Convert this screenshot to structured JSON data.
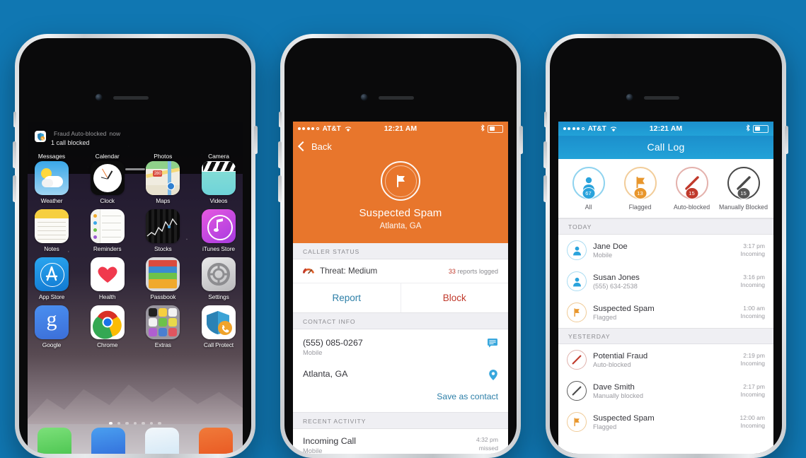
{
  "background_color": "#1077B2",
  "phone1": {
    "name": "iphone-home-screen",
    "notification": {
      "title": "Fraud Auto-blocked",
      "time": "now",
      "body": "1 call blocked"
    },
    "page_dots": {
      "count": 7,
      "active_index": 0
    },
    "apps_row_top_labels": [
      "Messages",
      "Calendar",
      "Photos",
      "Camera"
    ],
    "apps": [
      [
        {
          "label": "Weather",
          "icon": "weather-icon"
        },
        {
          "label": "Clock",
          "icon": "clock-icon"
        },
        {
          "label": "Maps",
          "icon": "maps-icon"
        },
        {
          "label": "Videos",
          "icon": "videos-icon"
        }
      ],
      [
        {
          "label": "Notes",
          "icon": "notes-icon"
        },
        {
          "label": "Reminders",
          "icon": "reminders-icon"
        },
        {
          "label": "Stocks",
          "icon": "stocks-icon"
        },
        {
          "label": "iTunes Store",
          "icon": "itunes-store-icon"
        }
      ],
      [
        {
          "label": "App Store",
          "icon": "app-store-icon"
        },
        {
          "label": "Health",
          "icon": "health-icon"
        },
        {
          "label": "Passbook",
          "icon": "passbook-icon"
        },
        {
          "label": "Settings",
          "icon": "settings-icon"
        }
      ],
      [
        {
          "label": "Google",
          "icon": "google-icon"
        },
        {
          "label": "Chrome",
          "icon": "chrome-icon"
        },
        {
          "label": "Extras",
          "icon": "extras-folder-icon"
        },
        {
          "label": "Call Protect",
          "icon": "call-protect-icon"
        }
      ]
    ],
    "dock": [
      "phone-icon",
      "mail-icon",
      "safari-icon",
      "music-icon"
    ]
  },
  "phone2": {
    "name": "spam-caller-detail",
    "status_bar": {
      "carrier": "AT&T",
      "time": "12:21 AM",
      "signal_dots_filled": 4,
      "signal_dots_total": 5,
      "bluetooth": true,
      "battery_percent": 45
    },
    "nav": {
      "back_label": "Back"
    },
    "hero": {
      "icon": "flag-badge-icon",
      "title": "Suspected Spam",
      "subtitle": "Atlanta, GA",
      "accent_color": "#E8762C"
    },
    "caller_status": {
      "section_label": "CALLER STATUS",
      "threat_icon": "threat-gauge-icon",
      "threat_label": "Threat: Medium",
      "reports_count": "33",
      "reports_label": "reports logged"
    },
    "actions": {
      "report_label": "Report",
      "report_color": "#2d7fa8",
      "block_label": "Block",
      "block_color": "#c0392b"
    },
    "contact_info": {
      "section_label": "CONTACT INFO",
      "rows": [
        {
          "main": "(555) 085-0267",
          "sub": "Mobile",
          "action_icon": "message-icon"
        },
        {
          "main": "Atlanta, GA",
          "sub": "",
          "action_icon": "map-pin-icon"
        }
      ],
      "save_link": "Save as contact"
    },
    "recent_activity": {
      "section_label": "RECENT ACTIVITY",
      "rows": [
        {
          "main": "Incoming Call",
          "sub": "Mobile",
          "time": "4:32 pm",
          "status": "missed"
        }
      ]
    }
  },
  "phone3": {
    "name": "call-log-screen",
    "status_bar": {
      "carrier": "AT&T",
      "time": "12:21 AM",
      "signal_dots_filled": 4,
      "signal_dots_total": 5,
      "bluetooth": true,
      "battery_percent": 45
    },
    "title": "Call Log",
    "filters": [
      {
        "label": "All",
        "badge": "67",
        "icon": "person-icon",
        "color": "#29A3DC",
        "badge_color": "#29A3DC"
      },
      {
        "label": "Flagged",
        "badge": "13",
        "icon": "flag-icon",
        "color": "#E8962C",
        "badge_color": "#E8962C"
      },
      {
        "label": "Auto-blocked",
        "badge": "15",
        "icon": "blocked-slash-icon",
        "color": "#C0392B",
        "badge_color": "#C0392B"
      },
      {
        "label": "Manually Blocked",
        "badge": "15",
        "icon": "manual-block-slash-icon",
        "color": "#4A4A4A",
        "badge_color": "#555555"
      }
    ],
    "sections": [
      {
        "label": "TODAY",
        "rows": [
          {
            "name": "Jane Doe",
            "sub": "Mobile",
            "time": "3:17 pm",
            "direction": "Incoming",
            "icon": "person-icon",
            "icon_color": "#29A3DC"
          },
          {
            "name": "Susan Jones",
            "sub": "(555) 634-2538",
            "time": "3:16 pm",
            "direction": "Incoming",
            "icon": "person-icon",
            "icon_color": "#29A3DC"
          },
          {
            "name": "Suspected Spam",
            "sub": "Flagged",
            "time": "1:00 am",
            "direction": "Incoming",
            "icon": "flag-icon",
            "icon_color": "#E8962C"
          }
        ]
      },
      {
        "label": "YESTERDAY",
        "rows": [
          {
            "name": "Potential Fraud",
            "sub": "Auto-blocked",
            "time": "2:19 pm",
            "direction": "Incoming",
            "icon": "blocked-slash-icon",
            "icon_color": "#C0392B"
          },
          {
            "name": "Dave Smith",
            "sub": "Manually blocked",
            "time": "2:17 pm",
            "direction": "Incoming",
            "icon": "manual-block-slash-icon",
            "icon_color": "#4A4A4A"
          },
          {
            "name": "Suspected Spam",
            "sub": "Flagged",
            "time": "12:00 am",
            "direction": "Incoming",
            "icon": "flag-icon",
            "icon_color": "#E8962C"
          }
        ]
      }
    ]
  }
}
